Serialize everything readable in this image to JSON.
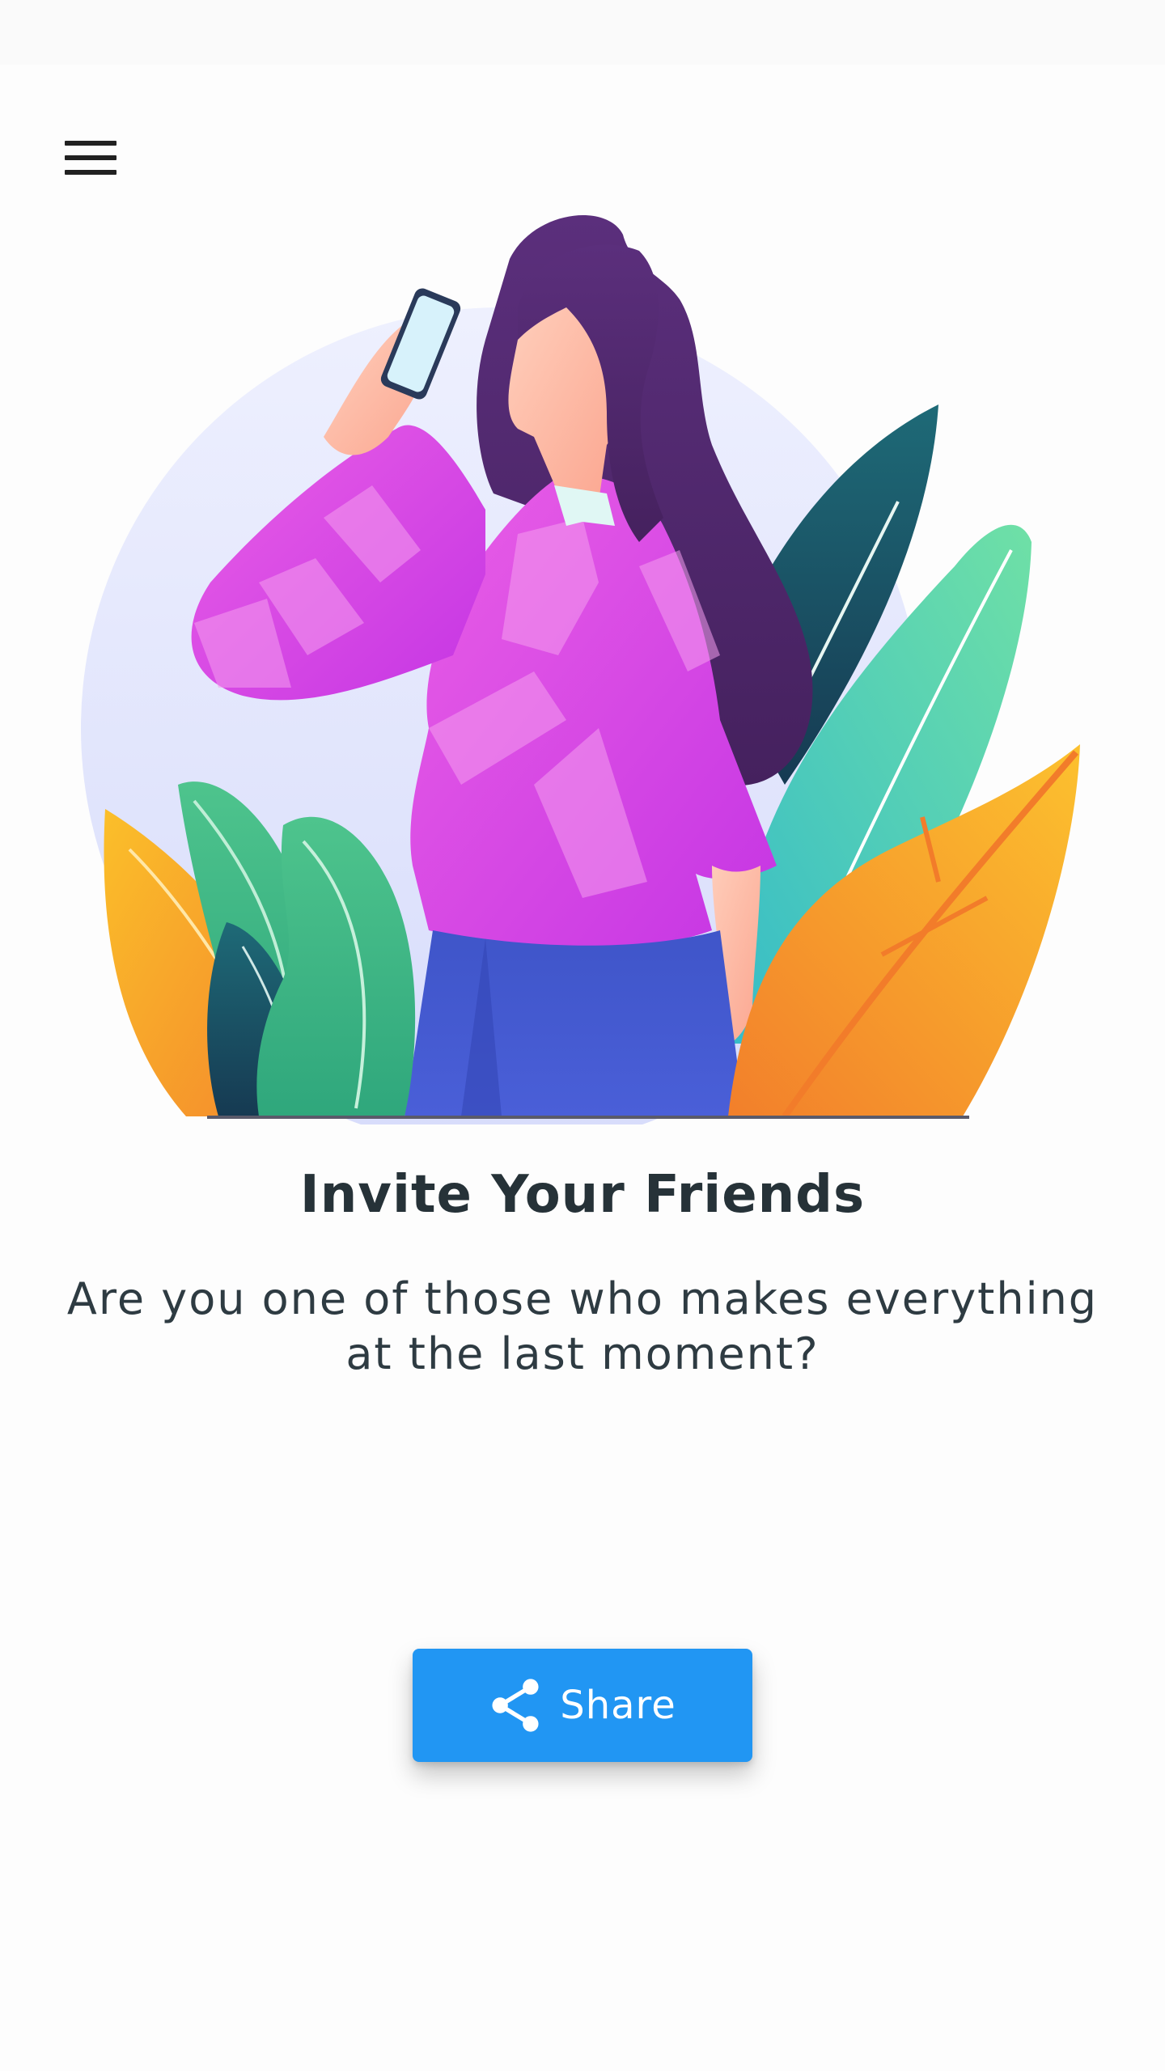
{
  "header": {
    "menu_icon": "hamburger-menu-icon"
  },
  "illustration": {
    "icon": "woman-on-phone-illustration"
  },
  "content": {
    "title": "Invite Your Friends",
    "subtitle": "Are you one of those who makes everything at the last moment?"
  },
  "actions": {
    "share_label": "Share",
    "share_icon": "share-icon",
    "share_color": "#2196f3"
  },
  "colors": {
    "title": "#263238",
    "background": "#fdfdfd"
  }
}
